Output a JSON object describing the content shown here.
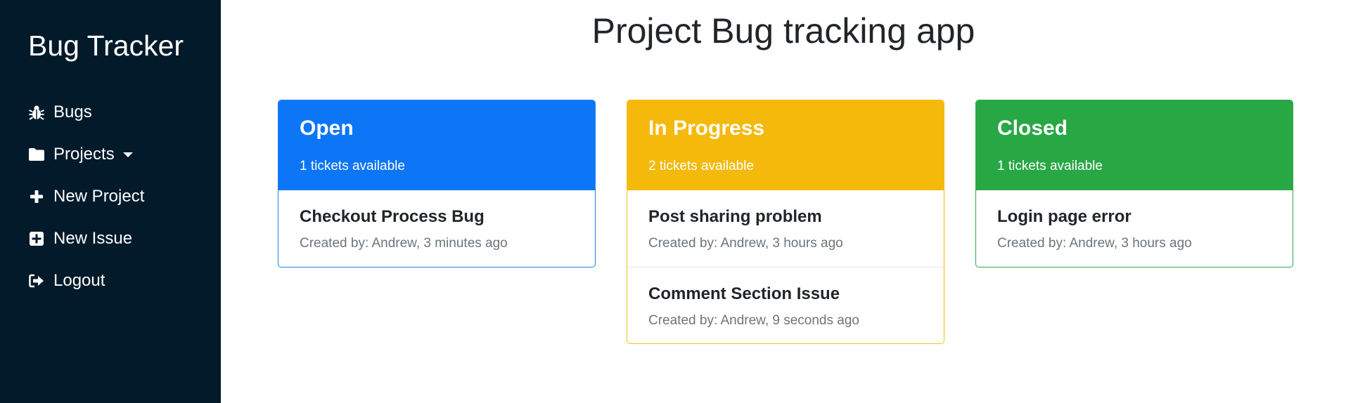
{
  "app": {
    "brand": "Bug Tracker"
  },
  "sidebar": {
    "items": [
      {
        "label": "Bugs",
        "icon": "bug-icon"
      },
      {
        "label": "Projects",
        "icon": "folder-icon",
        "has_dropdown": true
      },
      {
        "label": "New Project",
        "icon": "plus-icon"
      },
      {
        "label": "New Issue",
        "icon": "plus-square-icon"
      },
      {
        "label": "Logout",
        "icon": "sign-out-icon"
      }
    ]
  },
  "main": {
    "title": "Project Bug tracking app"
  },
  "colors": {
    "sidebar_bg": "#021a2a",
    "open": "#0d76f7",
    "in_progress": "#f5b90b",
    "closed": "#28a745",
    "muted_text": "#6c757d"
  },
  "columns": [
    {
      "title": "Open",
      "count_text": "1 tickets available",
      "tickets": [
        {
          "title": "Checkout Process Bug",
          "meta": "Created by: Andrew, 3 minutes ago"
        }
      ]
    },
    {
      "title": "In Progress",
      "count_text": "2 tickets available",
      "tickets": [
        {
          "title": "Post sharing problem",
          "meta": "Created by: Andrew, 3 hours ago"
        },
        {
          "title": "Comment Section Issue",
          "meta": "Created by: Andrew, 9 seconds ago"
        }
      ]
    },
    {
      "title": "Closed",
      "count_text": "1 tickets available",
      "tickets": [
        {
          "title": "Login page error",
          "meta": "Created by: Andrew, 3 hours ago"
        }
      ]
    }
  ]
}
